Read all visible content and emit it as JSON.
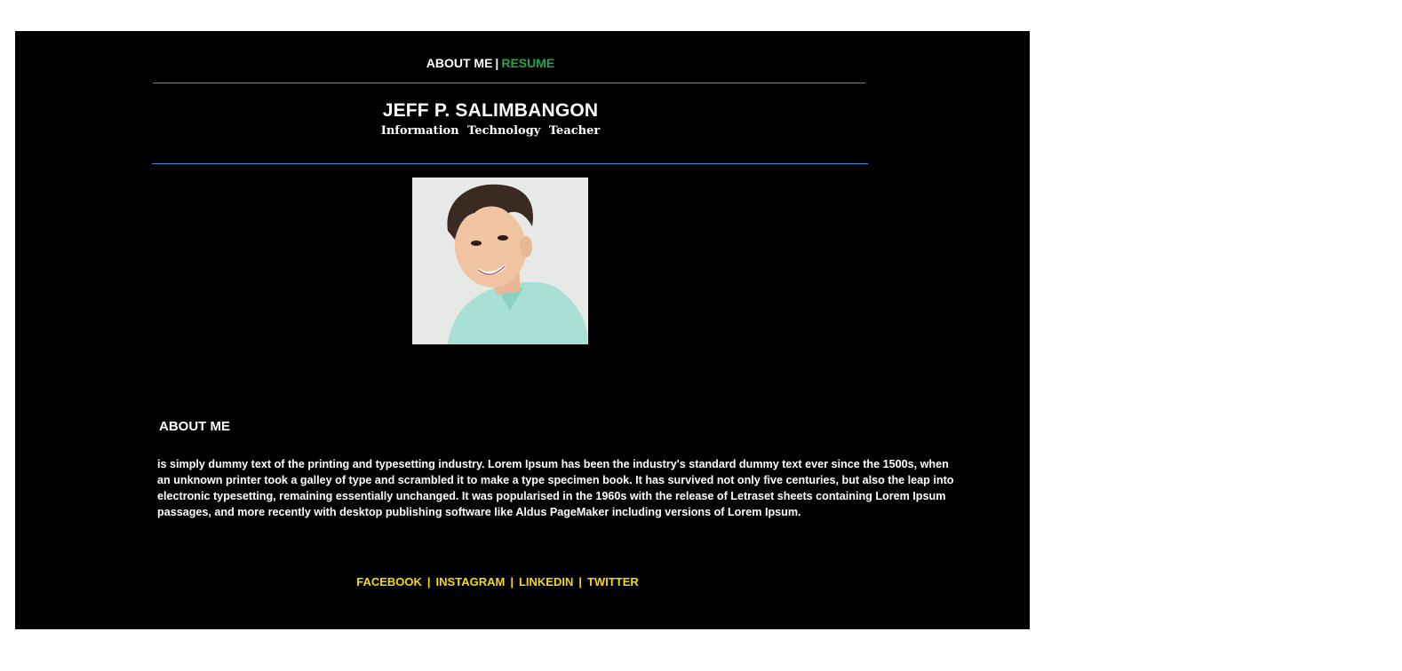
{
  "nav": {
    "about": "ABOUT ME",
    "separator": "|",
    "resume": "RESUME"
  },
  "header": {
    "name": "JEFF P. SALIMBANGON",
    "title": "Information Technology Teacher"
  },
  "about": {
    "heading": "ABOUT ME",
    "body": "is simply dummy text of the printing and typesetting industry. Lorem Ipsum has been the industry's standard dummy text ever since the 1500s, when an unknown printer took a galley of type and scrambled it to make a type specimen book. It has survived not only five centuries, but also the leap into electronic typesetting, remaining essentially unchanged. It was popularised in the 1960s with the release of Letraset sheets containing Lorem Ipsum passages, and more recently with desktop publishing software like Aldus PageMaker including versions of Lorem Ipsum."
  },
  "social": {
    "links": [
      "FACEBOOK",
      "INSTAGRAM",
      "LINKEDIN",
      "TWITTER"
    ],
    "divider": "|"
  },
  "colors": {
    "background": "#000000",
    "rule": "#3a8fd6",
    "resume_link": "#1ea84a",
    "social_links": "#f5d90a"
  }
}
